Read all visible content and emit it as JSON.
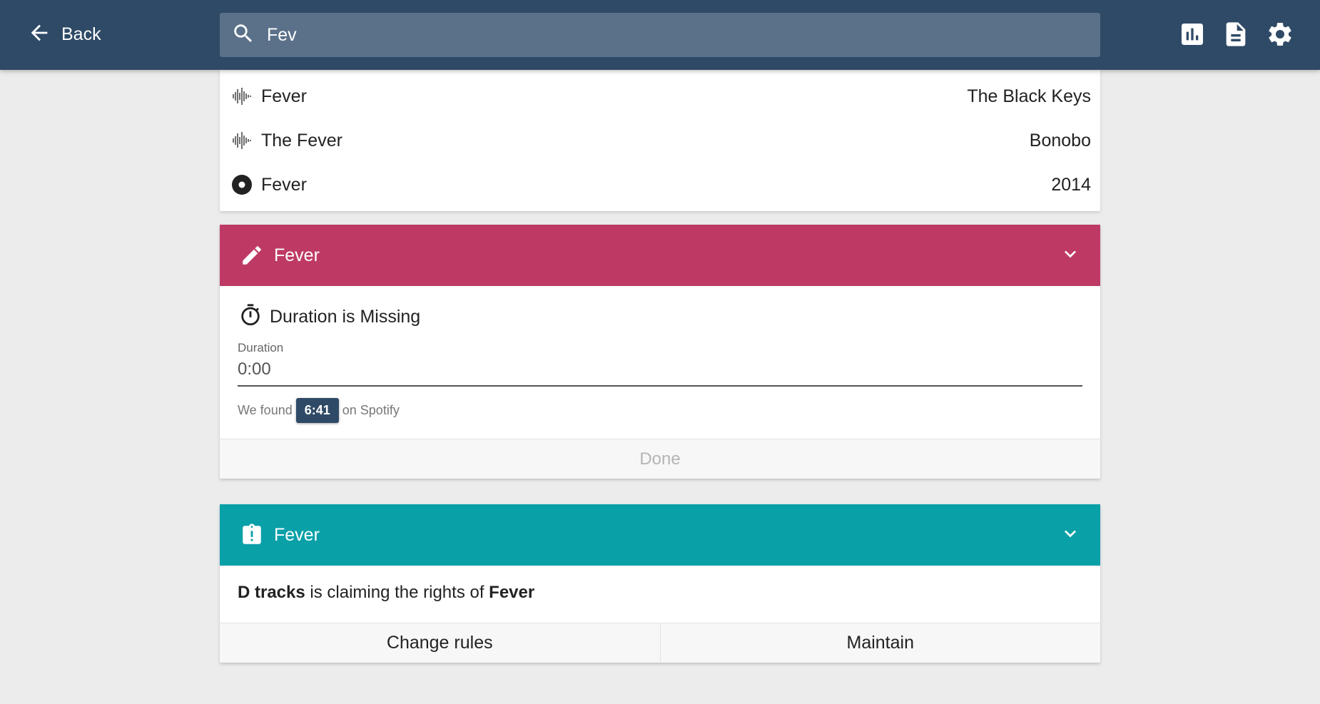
{
  "header": {
    "back_label": "Back",
    "search_value": "Fev",
    "actions": [
      "bar-chart-icon",
      "document-icon",
      "gear-icon"
    ]
  },
  "results": [
    {
      "icon": "waveform-icon",
      "title": "Fever",
      "meta": "The Black Keys"
    },
    {
      "icon": "waveform-icon",
      "title": "The Fever",
      "meta": "Bonobo"
    },
    {
      "icon": "album-icon",
      "title": "Fever",
      "meta": "2014"
    }
  ],
  "edit_card": {
    "color": "#be3a65",
    "title": "Fever",
    "issue": "Duration is Missing",
    "field_label": "Duration",
    "field_value": "0:00",
    "found_prefix": "We found",
    "found_value": "6:41",
    "found_suffix": "on Spotify",
    "done_label": "Done"
  },
  "rights_card": {
    "color": "#09a0a8",
    "title": "Fever",
    "claimant": "D tracks",
    "claim_text": " is claiming the rights of ",
    "claimed_title": "Fever",
    "change_label": "Change rules",
    "maintain_label": "Maintain"
  },
  "colors": {
    "topbar": "#2f4a66",
    "search_bg": "#5a7189",
    "background": "#ececec"
  }
}
